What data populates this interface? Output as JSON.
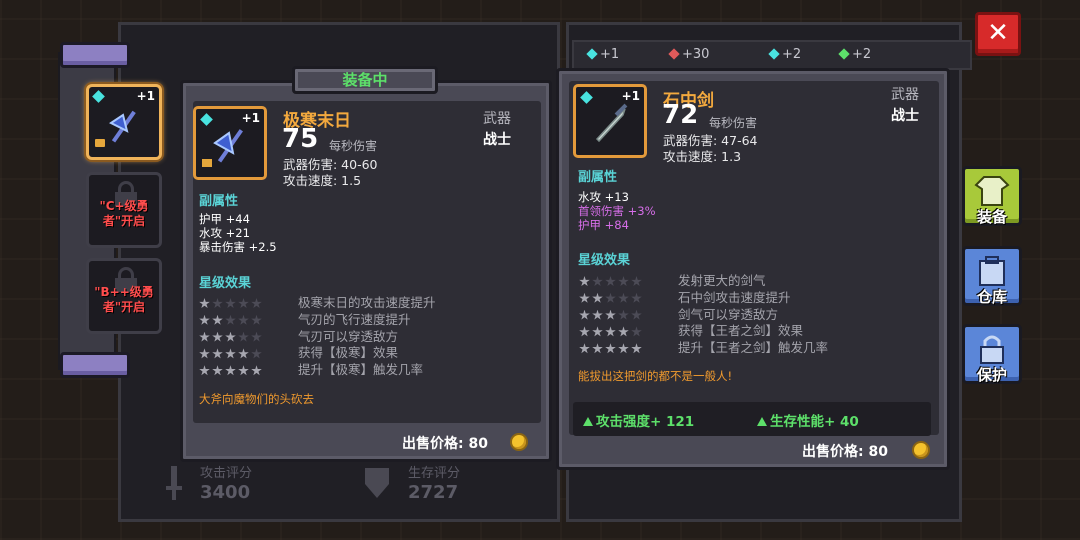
{
  "close_label": "✕",
  "slots": [
    {
      "plus": "+1"
    },
    {
      "text": "\"C+级勇者\"开启"
    },
    {
      "text": "\"B++级勇者\"开启"
    }
  ],
  "equipped": {
    "tab_label": "装备中",
    "name": "极寒末日",
    "plus": "+1",
    "dps": "75",
    "dps_label": "每秒伤害",
    "damage": "武器伤害: 40-60",
    "speed": "攻击速度: 1.5",
    "type": "武器",
    "class": "战士",
    "sub_title": "副属性",
    "attributes": [
      "护甲 +44",
      "水攻 +21",
      "暴击伤害 +2.5"
    ],
    "star_title": "星级效果",
    "star_effects": [
      {
        "stars": 1,
        "text": "极寒末日的攻击速度提升"
      },
      {
        "stars": 2,
        "text": "气刃的飞行速度提升"
      },
      {
        "stars": 3,
        "text": "气刃可以穿透敌方"
      },
      {
        "stars": 4,
        "text": "获得【极寒】效果"
      },
      {
        "stars": 5,
        "text": "提升【极寒】触发几率"
      }
    ],
    "flavor": "大斧向魔物们的头砍去",
    "price": "出售价格: 80"
  },
  "compare": {
    "name": "石中剑",
    "plus": "+1",
    "dps": "72",
    "dps_label": "每秒伤害",
    "damage": "武器伤害: 47-64",
    "speed": "攻击速度: 1.3",
    "type": "武器",
    "class": "战士",
    "sub_title": "副属性",
    "attributes": [
      {
        "text": "水攻 +13",
        "color": "white"
      },
      {
        "text": "首领伤害 +3%",
        "color": "purple"
      },
      {
        "text": "护甲 +84",
        "color": "purple"
      }
    ],
    "star_title": "星级效果",
    "star_effects": [
      {
        "stars": 1,
        "text": "发射更大的剑气"
      },
      {
        "stars": 2,
        "text": "石中剑攻击速度提升"
      },
      {
        "stars": 3,
        "text": "剑气可以穿透敌方"
      },
      {
        "stars": 4,
        "text": "获得【王者之剑】效果"
      },
      {
        "stars": 5,
        "text": "提升【王者之剑】触发几率"
      }
    ],
    "flavor": "能拔出这把剑的都不是一般人!",
    "attack_gain": "攻击强度+ 121",
    "survive_gain": "生存性能+ 40",
    "price": "出售价格: 80"
  },
  "side_buttons": [
    {
      "label": "装备",
      "icon": "shirt-icon",
      "color": "#a8c93a"
    },
    {
      "label": "仓库",
      "icon": "backpack-icon",
      "color": "#5b86d8"
    },
    {
      "label": "保护",
      "icon": "lock-icon",
      "color": "#5b86d8"
    }
  ],
  "currency": [
    {
      "value": "+1",
      "color": "#49e3e0"
    },
    {
      "value": "+30",
      "color": "#e05a5a"
    },
    {
      "value": "+2",
      "color": "#49e3e0"
    },
    {
      "value": "+2",
      "color": "#5de06a"
    }
  ],
  "scores": {
    "attack_label": "攻击评分",
    "attack_value": "3400",
    "survive_label": "生存评分",
    "survive_value": "2727"
  }
}
